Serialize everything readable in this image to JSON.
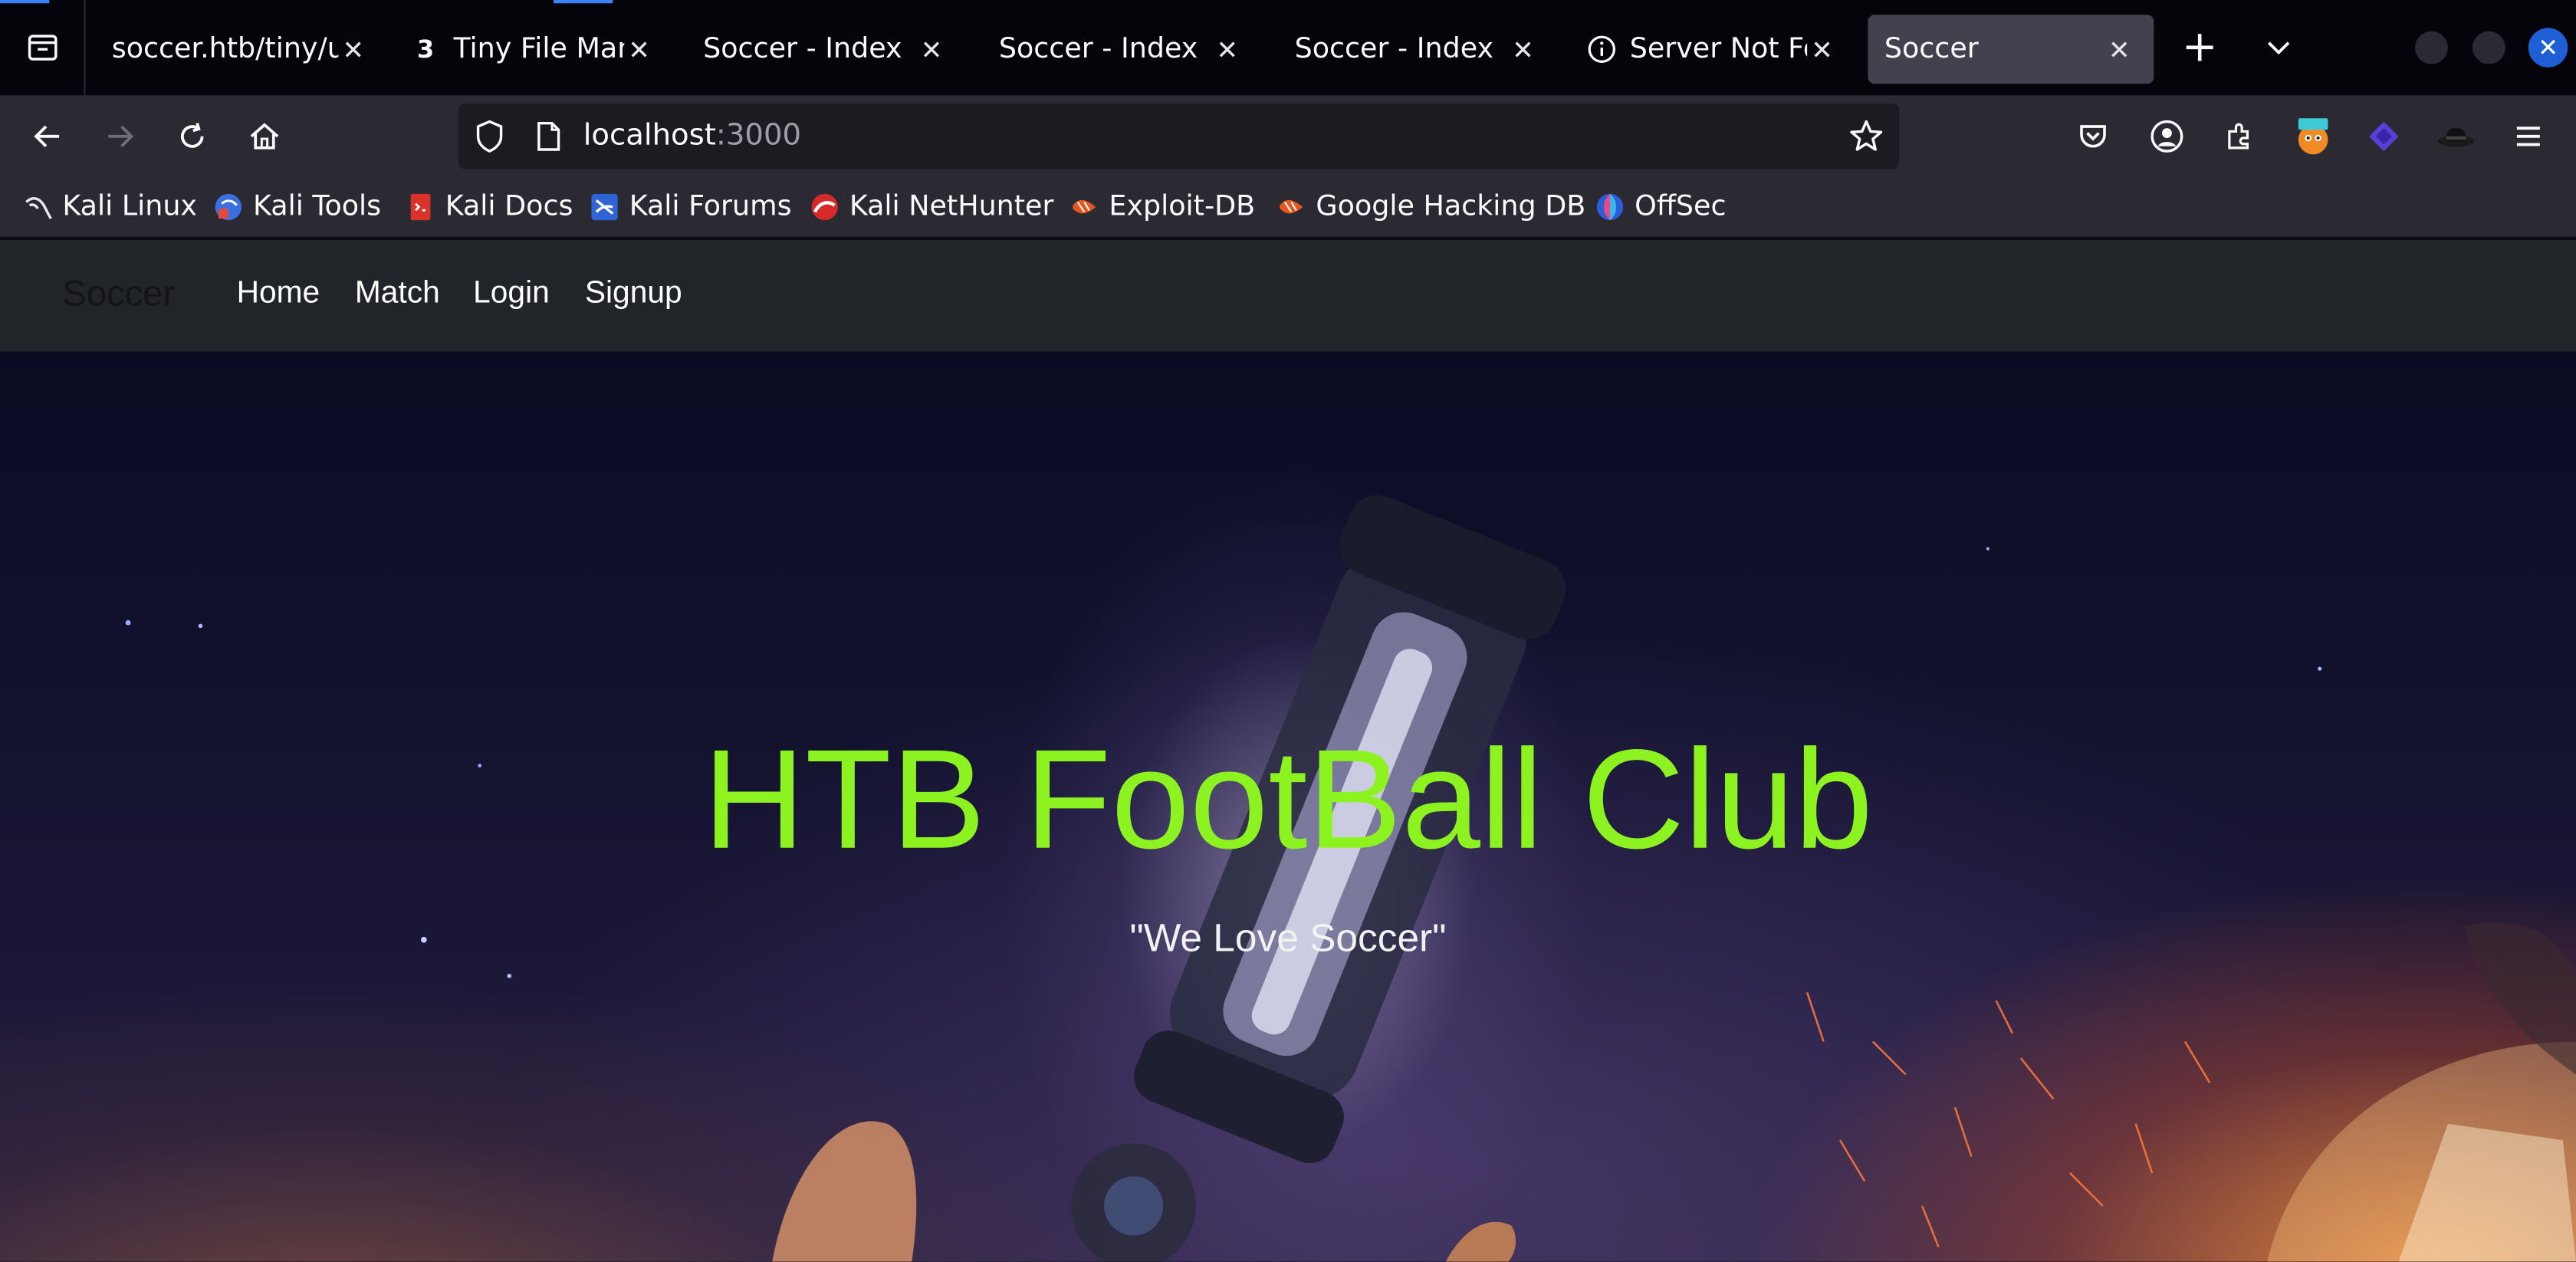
{
  "browser": {
    "tabs": [
      {
        "title": "soccer.htb/tiny/u",
        "favicon": "",
        "selected": false
      },
      {
        "title": "Tiny File Mana",
        "favicon": "3",
        "selected": false
      },
      {
        "title": "Soccer - Index",
        "favicon": "",
        "selected": false
      },
      {
        "title": "Soccer - Index",
        "favicon": "",
        "selected": false
      },
      {
        "title": "Soccer - Index",
        "favicon": "",
        "selected": false
      },
      {
        "title": "Server Not Fo",
        "favicon": "info-icon",
        "selected": false
      },
      {
        "title": "Soccer",
        "favicon": "",
        "selected": true
      }
    ],
    "close_glyph": "✕",
    "new_tab_glyph": "+",
    "url": {
      "host": "localhost",
      "port": ":3000"
    },
    "bookmarks": [
      {
        "label": "Kali Linux",
        "icon": "kali-dragon-icon"
      },
      {
        "label": "Kali Tools",
        "icon": "kali-tools-icon"
      },
      {
        "label": "Kali Docs",
        "icon": "kali-docs-icon"
      },
      {
        "label": "Kali Forums",
        "icon": "kali-forums-icon"
      },
      {
        "label": "Kali NetHunter",
        "icon": "nethunter-icon"
      },
      {
        "label": "Exploit-DB",
        "icon": "exploit-db-icon"
      },
      {
        "label": "Google Hacking DB",
        "icon": "ghdb-icon"
      },
      {
        "label": "OffSec",
        "icon": "offsec-icon"
      }
    ],
    "extensions": [
      "pocket-icon",
      "account-icon",
      "extensions-icon",
      "burp-icon",
      "foxyproxy-icon",
      "hat-icon",
      "menu-icon"
    ],
    "accent": "#3b82f6"
  },
  "site": {
    "brand": "Soccer",
    "nav": [
      "Home",
      "Match",
      "Login",
      "Signup"
    ],
    "hero_title": "HTB FootBall Club",
    "hero_subtitle": "\"We Love Soccer\"",
    "title_color": "#8cf321"
  }
}
